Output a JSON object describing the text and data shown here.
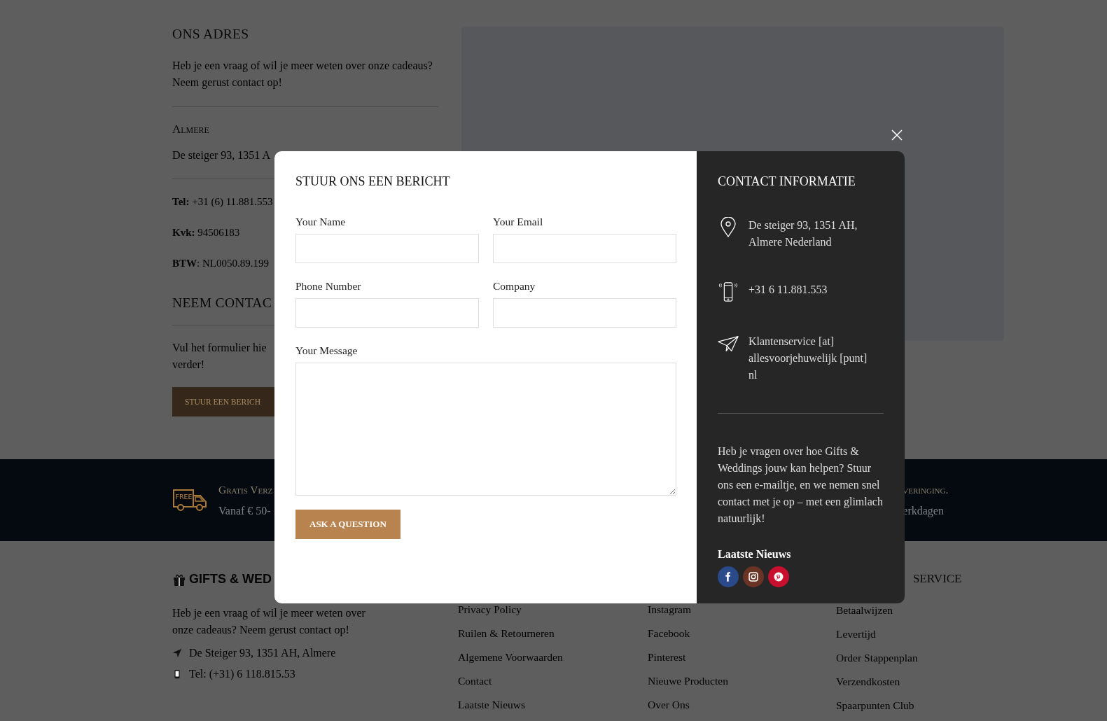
{
  "address_section": {
    "title": "ONS ADRES",
    "intro": "Heb je een vraag of wil je meer weten over onze cadeaus? Neem gerust contact op!",
    "city": "Almere",
    "address": "De steiger 93, 1351 A",
    "details": [
      "**Tel:** +31 (6) 11.881.553",
      "**Kvk:** 94506183",
      "**BTW**: NL0050.89.199"
    ]
  },
  "contact_section": {
    "title": "NEEM CONTAC",
    "lines": [
      "Vul het formulier hie",
      "verder!"
    ],
    "button": "STUUR EEN BERICH"
  },
  "features_band": [
    {
      "badge": "FREE",
      "title": "Gratis Verz",
      "subtitle": "Vanaf € 50-"
    },
    {
      "title": "veringing.",
      "subtitle": "erkdagen"
    }
  ],
  "footer": {
    "logo": "GIFTS & WED",
    "about": "Heb je een vraag of wil je meer weten over onze cadeaus? Neem gerust contact op!",
    "contacts": [
      {
        "kind": "location",
        "text": "De Steiger 93, 1351 AH, Almere"
      },
      {
        "kind": "phone",
        "text": "Tel: (+31) 6 118.815.53"
      }
    ],
    "columns": [
      {
        "links": [
          "Privacy Policy",
          "Ruilen & Retourneren",
          "Algemene Voorwaarden",
          "Contact",
          "Laatste Nieuws"
        ]
      },
      {
        "links": [
          "Instagram",
          "Facebook",
          "Pinterest",
          "Nieuwe Producten",
          "Over Ons"
        ]
      },
      {
        "heading": "SERVICE",
        "links": [
          "Betaalwijzen",
          "Levertijd",
          "Order Stappenplan",
          "Verzendkosten",
          "Spaarpunten Club"
        ]
      }
    ]
  },
  "modal": {
    "title": "STUUR ONS EEN BERICHT",
    "fields": [
      {
        "label": "Your Name",
        "kind": "input"
      },
      {
        "label": "Your Email",
        "kind": "input"
      },
      {
        "label": "Phone Number",
        "kind": "input"
      },
      {
        "label": "Company",
        "kind": "input"
      },
      {
        "label": "Your Message",
        "kind": "textarea"
      }
    ],
    "submit": "ASK A QUESTION",
    "info": {
      "title": "CONTACT INFORMATIE",
      "items": [
        {
          "kind": "location",
          "text": "De steiger 93, 1351 AH, Almere Nederland"
        },
        {
          "kind": "phone",
          "text": "+31 6 11.881.553"
        },
        {
          "kind": "email",
          "text": "Klantenservice [at] allesvoorjehuwelijk [punt] nl"
        }
      ],
      "text": "Heb je vragen over hoe Gifts & Weddings jouw kan helpen? Stuur ons een e-mailtje, en we nemen snel contact met je op – met een glimlach natuurlijk!",
      "news_title": "Laatste Nieuws",
      "socials": [
        {
          "kind": "facebook",
          "color": "#2b4a8b"
        },
        {
          "kind": "instagram",
          "color": "#6b3324"
        },
        {
          "kind": "pinterest",
          "color": "#c8102e"
        }
      ]
    }
  }
}
